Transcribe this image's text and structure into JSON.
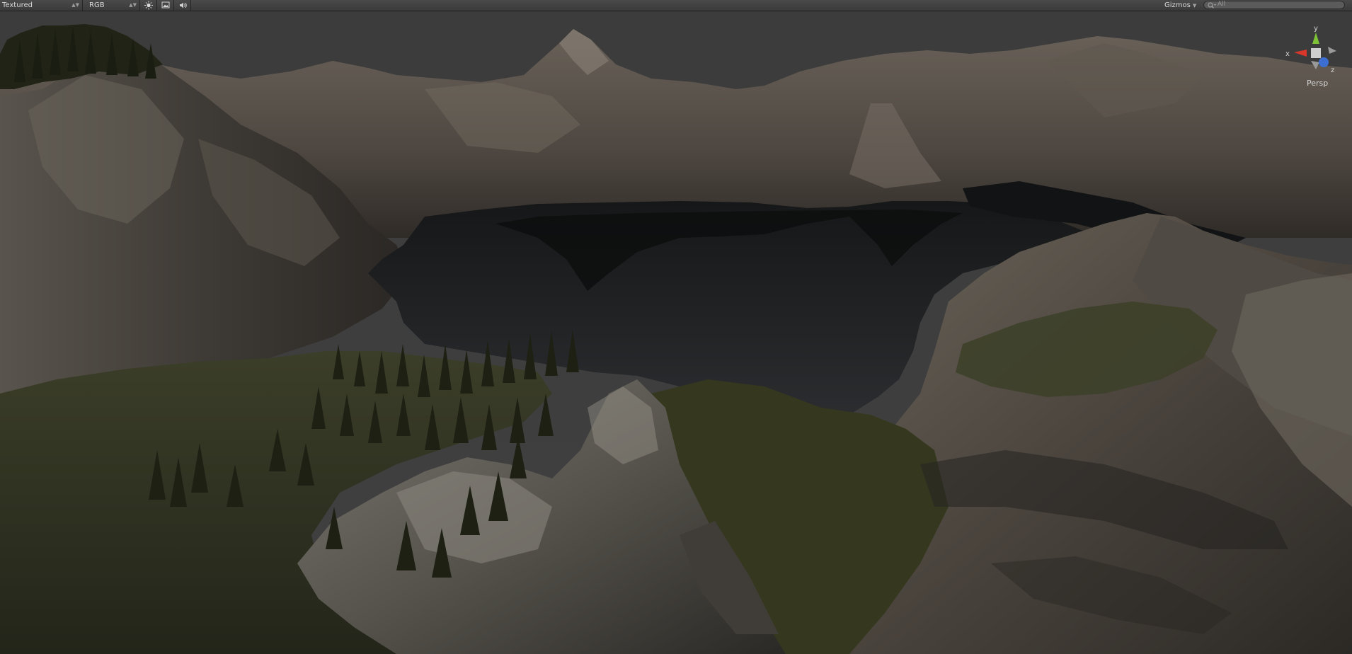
{
  "toolbar": {
    "draw_mode": "Textured",
    "render_mode": "RGB",
    "buttons": [
      {
        "name": "sun-icon"
      },
      {
        "name": "image-icon"
      },
      {
        "name": "speaker-icon"
      }
    ],
    "gizmos_label": "Gizmos",
    "search": {
      "placeholder": "All"
    }
  },
  "viewport": {
    "projection_label": "Persp",
    "axes": {
      "x": "x",
      "y": "y",
      "z": "z"
    }
  },
  "colors": {
    "toolbar_bg": "#3d3d3d",
    "sky": "#3d3d3d",
    "lake": "#202224",
    "grass": "#3a3d27",
    "rock": "#5c544a",
    "axis_x": "#d9362c",
    "axis_y": "#7ec235",
    "axis_z": "#3c6fd1"
  }
}
